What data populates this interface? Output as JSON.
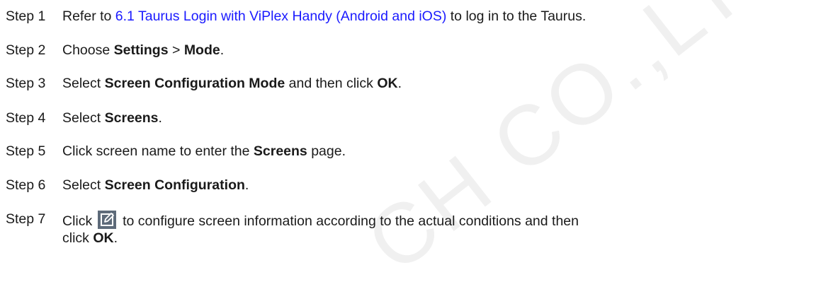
{
  "watermark": {
    "text": "CH CO.,LTD"
  },
  "steps": [
    {
      "label": "Step 1",
      "pre": "Refer to ",
      "link": "6.1 Taurus Login with ViPlex Handy (Android and iOS)",
      "post": " to log in to the Taurus."
    },
    {
      "label": "Step 2",
      "pre": "Choose ",
      "b1": "Settings",
      "mid": " > ",
      "b2": "Mode",
      "post": "."
    },
    {
      "label": "Step 3",
      "pre": "Select ",
      "b1": "Screen Configuration Mode",
      "mid": " and then click ",
      "b2": "OK",
      "post": "."
    },
    {
      "label": "Step 4",
      "pre": "Select ",
      "b1": "Screens",
      "post": "."
    },
    {
      "label": "Step 5",
      "pre": "Click screen name to enter the ",
      "b1": "Screens",
      "post": " page."
    },
    {
      "label": "Step 6",
      "pre": "Select ",
      "b1": "Screen Configuration",
      "post": "."
    },
    {
      "label": "Step 7",
      "pre": "Click ",
      "icon": "edit-icon",
      "line1": " to configure screen information according to the actual conditions and then",
      "line2_pre": "click ",
      "b1": "OK",
      "post": "."
    }
  ]
}
